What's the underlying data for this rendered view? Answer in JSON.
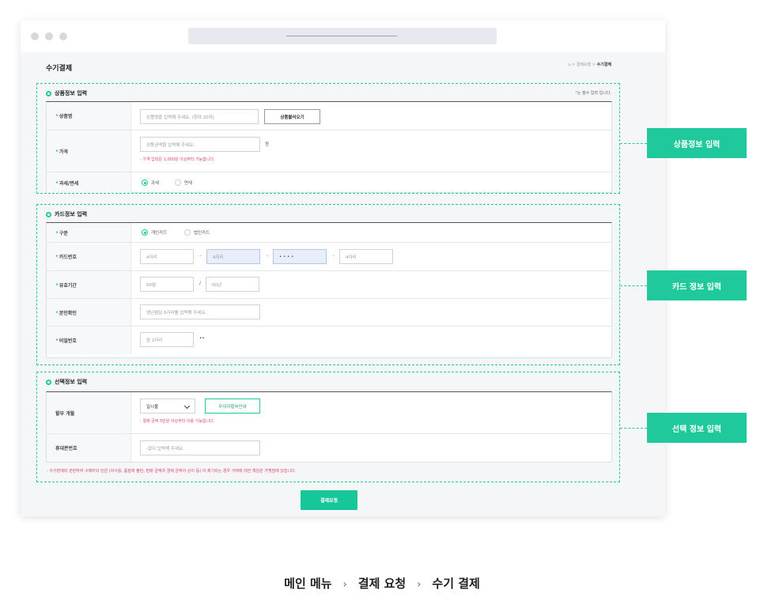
{
  "page": {
    "title": "수기결제"
  },
  "breadcrumb": {
    "home": "⌂",
    "sep": ">",
    "item1": "결제요청",
    "current": "수기결제"
  },
  "product_section": {
    "title": "상품정보 입력",
    "required_note_mark": "*",
    "required_note": "는 필수 입력 입니다.",
    "name_label": "상품명",
    "name_placeholder": "상품명을 입력해 주세요. (최대 20자)",
    "load_button": "상품불러오기",
    "price_label": "가격",
    "price_placeholder": "상품금액을 입력해 주세요.",
    "price_unit": "원",
    "price_error": "- 가격 입력은 1,000원 이상부터 가능합니다.",
    "tax_label": "과세/면세",
    "tax_options": [
      "과세",
      "면세"
    ],
    "tax_selected": "과세"
  },
  "card_section": {
    "title": "카드정보 입력",
    "type_label": "구분",
    "type_options": [
      "개인카드",
      "법인카드"
    ],
    "type_selected": "개인카드",
    "number_label": "카드번호",
    "number_fields": [
      "4자리",
      "4자리",
      "• • • •",
      "4자리"
    ],
    "number_sep": "-",
    "expiry_label": "유효기간",
    "expiry_month": "00월",
    "expiry_sep": "/",
    "expiry_year": "00년",
    "identity_label": "본인확인",
    "identity_placeholder": "생년월일 6자리를 입력해 주세요.",
    "password_label": "비밀번호",
    "password_placeholder": "앞 2자리",
    "password_mask": "••"
  },
  "optional_section": {
    "title": "선택정보 입력",
    "installment_label": "할부 개월",
    "installment_value": "일시불",
    "interest_free_button": "무이자할부안내",
    "installment_note": "- 결제 금액 5만원 이상부터 이용 가능합니다.",
    "phone_label": "휴대폰번호",
    "phone_placeholder": "-없이 입력해 주세요.",
    "notice": "- 수기판매와 관련하여 구매자의 민원 (미사용, 품질에 불만, 판매 금액과 결제 금액의 상이 등) 이 제기되는 경우 거래에 대한 책임은 가맹점에 있습니다."
  },
  "submit_button": "결제요청",
  "callouts": [
    "상품정보 입력",
    "카드 정보 입력",
    "선택 정보 입력"
  ],
  "footer_nav": {
    "items": [
      "메인 메뉴",
      "결제 요청",
      "수기 결제"
    ],
    "sep": "›"
  },
  "colors": {
    "accent": "#1fc99b",
    "error": "#e0436b"
  }
}
